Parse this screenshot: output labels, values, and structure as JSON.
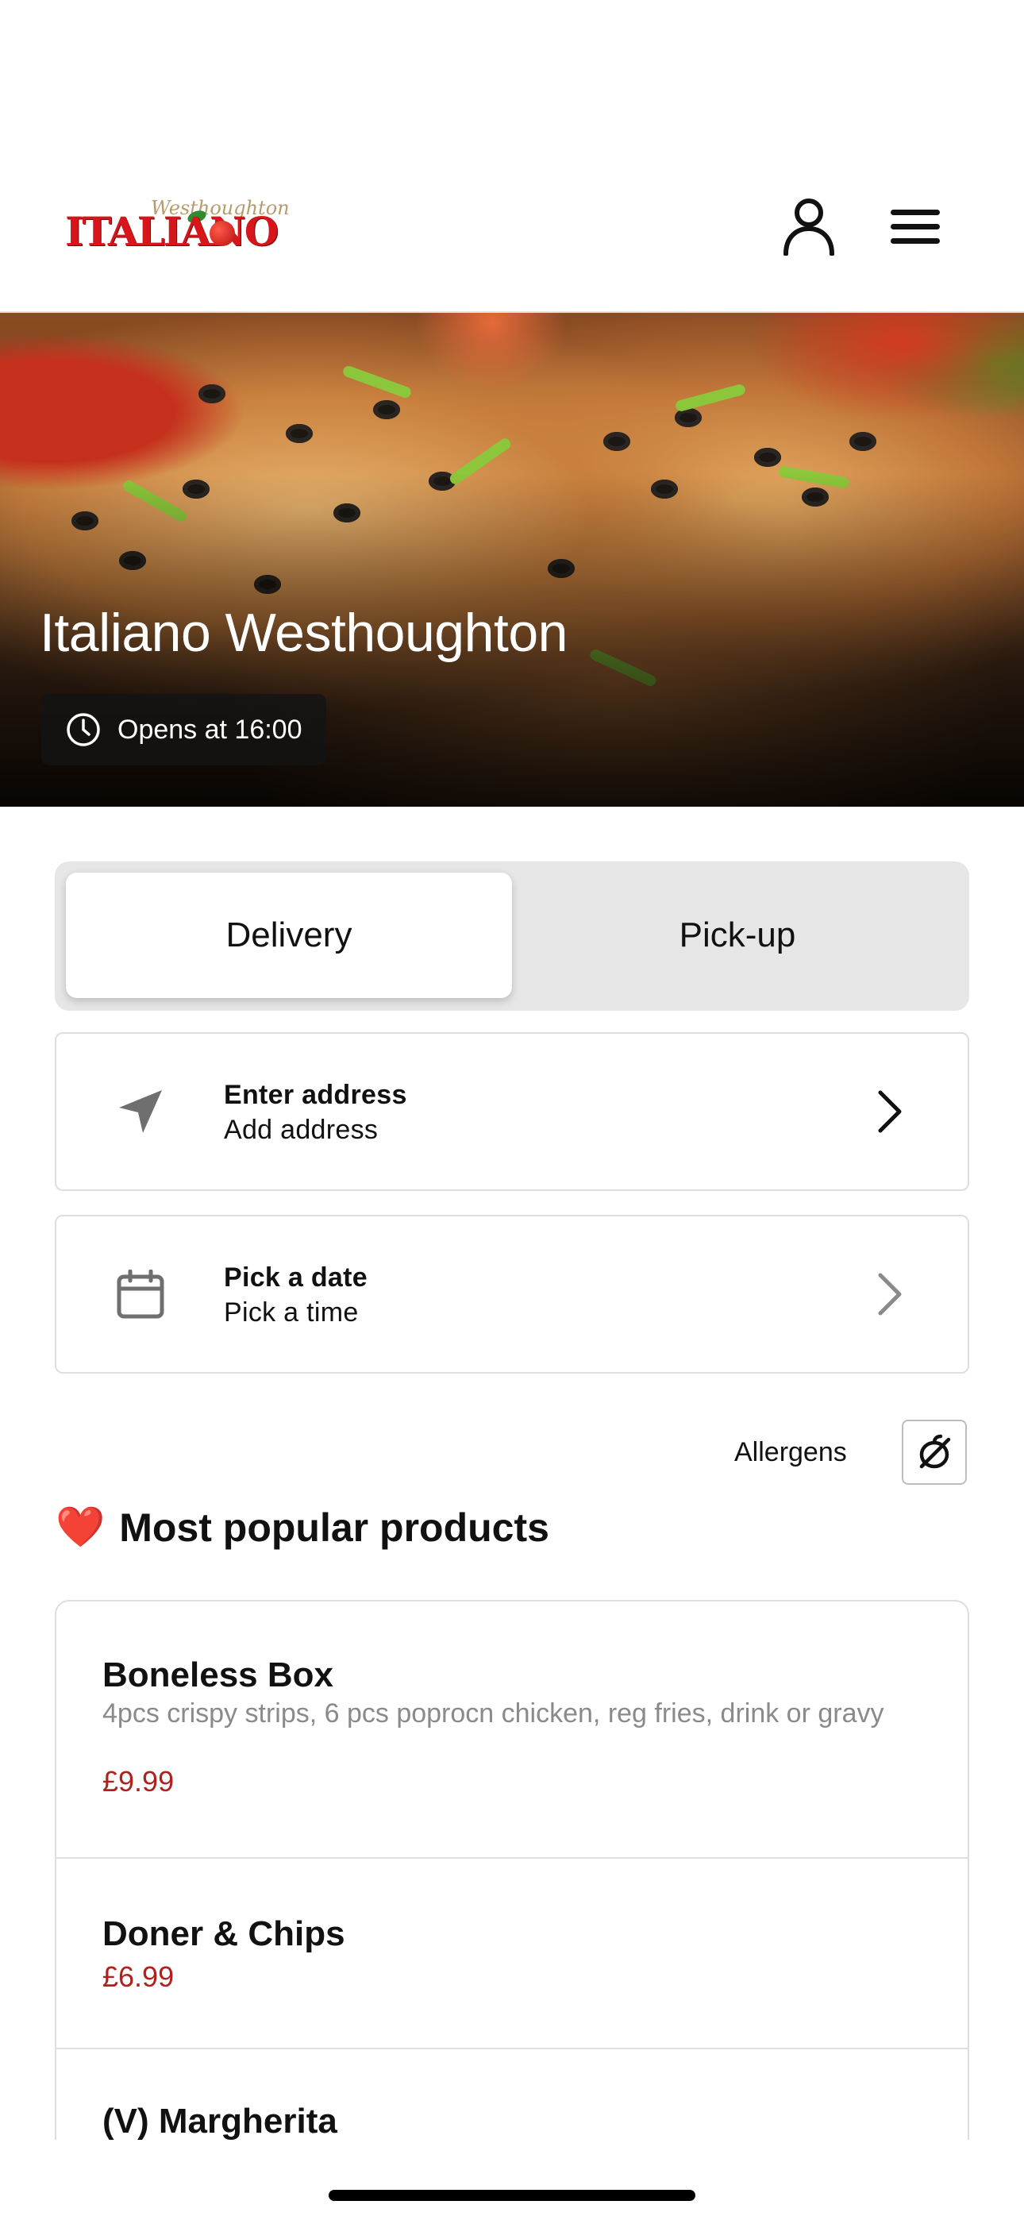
{
  "header": {
    "logo_main": "ITALIANO",
    "logo_sub": "Westhoughton"
  },
  "hero": {
    "restaurant_name": "Italiano Westhoughton",
    "hours_text": "Opens at 16:00"
  },
  "order_toggle": {
    "delivery_label": "Delivery",
    "pickup_label": "Pick-up",
    "selected": "Delivery"
  },
  "address_row": {
    "title": "Enter address",
    "subtitle": "Add address"
  },
  "date_row": {
    "title": "Pick a date",
    "subtitle": "Pick a time"
  },
  "allergens": {
    "label": "Allergens"
  },
  "popular": {
    "emoji": "❤️",
    "title": "Most popular products",
    "products": [
      {
        "name": "Boneless Box",
        "description": "4pcs crispy strips, 6 pcs poprocn chicken, reg fries, drink or gravy",
        "price": "£9.99"
      },
      {
        "name": "Doner & Chips",
        "description": "",
        "price": "£6.99"
      },
      {
        "name": "(V) Margherita",
        "description": "",
        "price": ""
      }
    ]
  },
  "colors": {
    "price": "#b0201c",
    "toggle_bg": "#e6e6e6",
    "brand_red": "#d7161c"
  }
}
